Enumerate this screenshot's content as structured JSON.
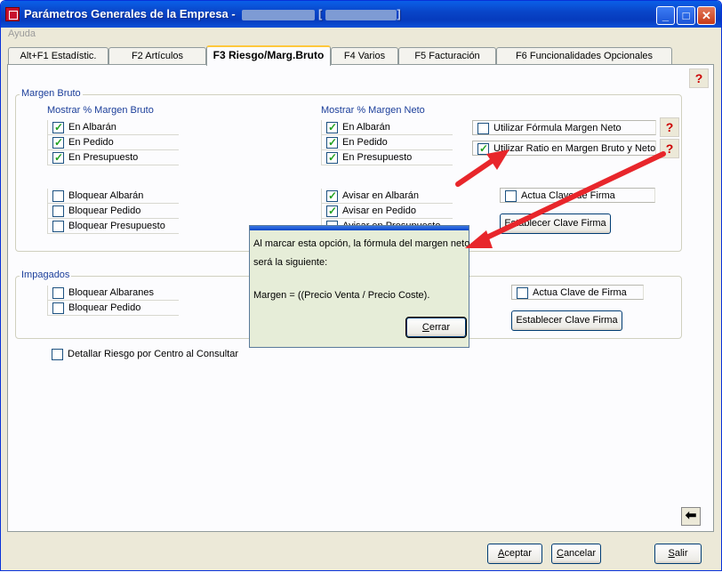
{
  "window": {
    "title": "Parámetros Generales de la Empresa -",
    "title_separator": "-"
  },
  "menu": {
    "help": "Ayuda"
  },
  "tabs": [
    {
      "label": "Alt+F1 Estadístic."
    },
    {
      "label": "F2 Artículos"
    },
    {
      "label": "F3 Riesgo/Marg.Bruto"
    },
    {
      "label": "F4 Varios"
    },
    {
      "label": "F5 Facturación"
    },
    {
      "label": "F6 Funcionalidades Opcionales"
    }
  ],
  "margen_bruto": {
    "group_label": "Margen Bruto",
    "mostrar_bruto_label": "Mostrar % Margen Bruto",
    "mostrar_bruto": [
      {
        "label": "En Albarán",
        "checked": true
      },
      {
        "label": "En Pedido",
        "checked": true
      },
      {
        "label": "En Presupuesto",
        "checked": true
      }
    ],
    "mostrar_neto_label": "Mostrar % Margen Neto",
    "mostrar_neto": [
      {
        "label": "En Albarán",
        "checked": true
      },
      {
        "label": "En Pedido",
        "checked": true
      },
      {
        "label": "En Presupuesto",
        "checked": true
      }
    ],
    "utilizar_formula": {
      "label": "Utilizar Fórmula Margen Neto",
      "checked": false
    },
    "utilizar_ratio": {
      "label": "Utilizar Ratio en Margen Bruto y Neto",
      "checked": true
    },
    "bloquear": [
      {
        "label": "Bloquear Albarán",
        "checked": false
      },
      {
        "label": "Bloquear Pedido",
        "checked": false
      },
      {
        "label": "Bloquear Presupuesto",
        "checked": false
      }
    ],
    "avisar": [
      {
        "label": "Avisar en Albarán",
        "checked": true
      },
      {
        "label": "Avisar en Pedido",
        "checked": true
      },
      {
        "label": "Avisar en Presupuesto",
        "checked": false
      }
    ],
    "actua_clave": {
      "label": "Actua Clave de Firma",
      "checked": false
    },
    "establecer_clave": "Establecer Clave Firma"
  },
  "impagados": {
    "group_label": "Impagados",
    "bloquear": [
      {
        "label": "Bloquear Albaranes",
        "checked": false
      },
      {
        "label": "Bloquear Pedido",
        "checked": false
      }
    ],
    "actua_clave": {
      "label": "Actua Clave de Firma",
      "checked": false
    },
    "establecer_clave": "Establecer Clave Firma"
  },
  "detallar_riesgo": {
    "label": "Detallar Riesgo por Centro al Consultar",
    "checked": false
  },
  "popup": {
    "line1": "Al marcar esta opción, la fórmula del margen neto",
    "line2": "será la siguiente:",
    "line3": "Margen = ((Precio Venta / Precio Coste).",
    "close_button": "Cerrar"
  },
  "footer": {
    "accept": "Aceptar",
    "cancel": "Cancelar",
    "exit": "Salir"
  },
  "colors": {
    "title_bar": "#0a4fd8",
    "group_label": "#1b3e9a",
    "popup_bg": "#e6edd8",
    "arrow": "#e8262b",
    "check": "#21a121"
  },
  "icons": {
    "help": "question-help-icon",
    "back": "arrow-left-icon",
    "app": "app-logo-icon"
  }
}
